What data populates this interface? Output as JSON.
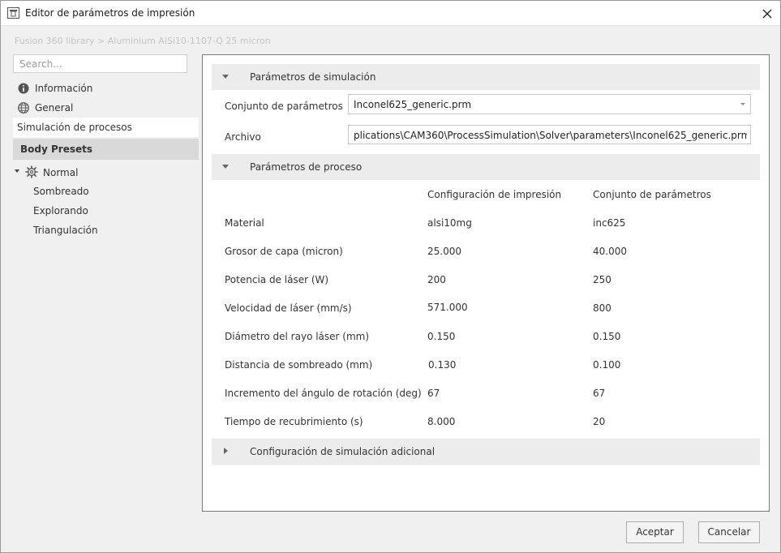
{
  "window": {
    "title": "Editor de parámetros de impresión"
  },
  "breadcrumb": "Fusion 360 library > Aluminium AlSi10-1107-Q 25 micron",
  "search": {
    "placeholder": "Search..."
  },
  "sidebar": {
    "items": [
      {
        "label": "Información",
        "icon": "info-icon"
      },
      {
        "label": "General",
        "icon": "globe-icon"
      }
    ],
    "selected": "Simulación de procesos",
    "group": "Body Presets",
    "tree": {
      "root": {
        "label": "Normal",
        "icon": "gear-icon",
        "expanded": true
      },
      "children": [
        "Sombreado",
        "Explorando",
        "Triangulación"
      ]
    }
  },
  "sections": {
    "simulation": {
      "title": "Parámetros de simulación",
      "expanded": true
    },
    "process": {
      "title": "Parámetros de proceso",
      "expanded": true
    },
    "additional": {
      "title": "Configuración de simulación adicional",
      "expanded": false
    }
  },
  "simulation_fields": {
    "paramset_label": "Conjunto de parámetros",
    "paramset_value": "Inconel625_generic.prm",
    "file_label": "Archivo",
    "file_value": "plications\\CAM360\\ProcessSimulation\\Solver\\parameters\\Inconel625_generic.prm"
  },
  "process_table": {
    "columns": [
      "Configuración de impresión",
      "Conjunto de parámetros"
    ],
    "rows": [
      {
        "label": "Material",
        "print": "alsi10mg",
        "paramset": "inc625"
      },
      {
        "label": "Grosor de capa (micron)",
        "print": "25.000",
        "paramset": "40.000"
      },
      {
        "label": "Potencia de láser (W)",
        "print": "200",
        "paramset": "250"
      },
      {
        "label": "Velocidad de láser (mm/s)",
        "print": "571.000",
        "paramset": "800"
      },
      {
        "label": "Diámetro del rayo láser (mm)",
        "print": "0.150",
        "paramset": "0.150"
      },
      {
        "label": "Distancia de sombreado (mm)",
        "print": "0.130",
        "paramset": "0.100"
      },
      {
        "label": "Incremento del ángulo de rotación (deg)",
        "print": "67",
        "paramset": "67"
      },
      {
        "label": "Tiempo de recubrimiento (s)",
        "print": "8.000",
        "paramset": "20"
      }
    ]
  },
  "buttons": {
    "accept": "Aceptar",
    "cancel": "Cancelar"
  },
  "colors": {
    "selected_group_bg": "#d9d9d9",
    "section_header_bg": "#ececec",
    "panel_border": "#7a7a7a"
  }
}
